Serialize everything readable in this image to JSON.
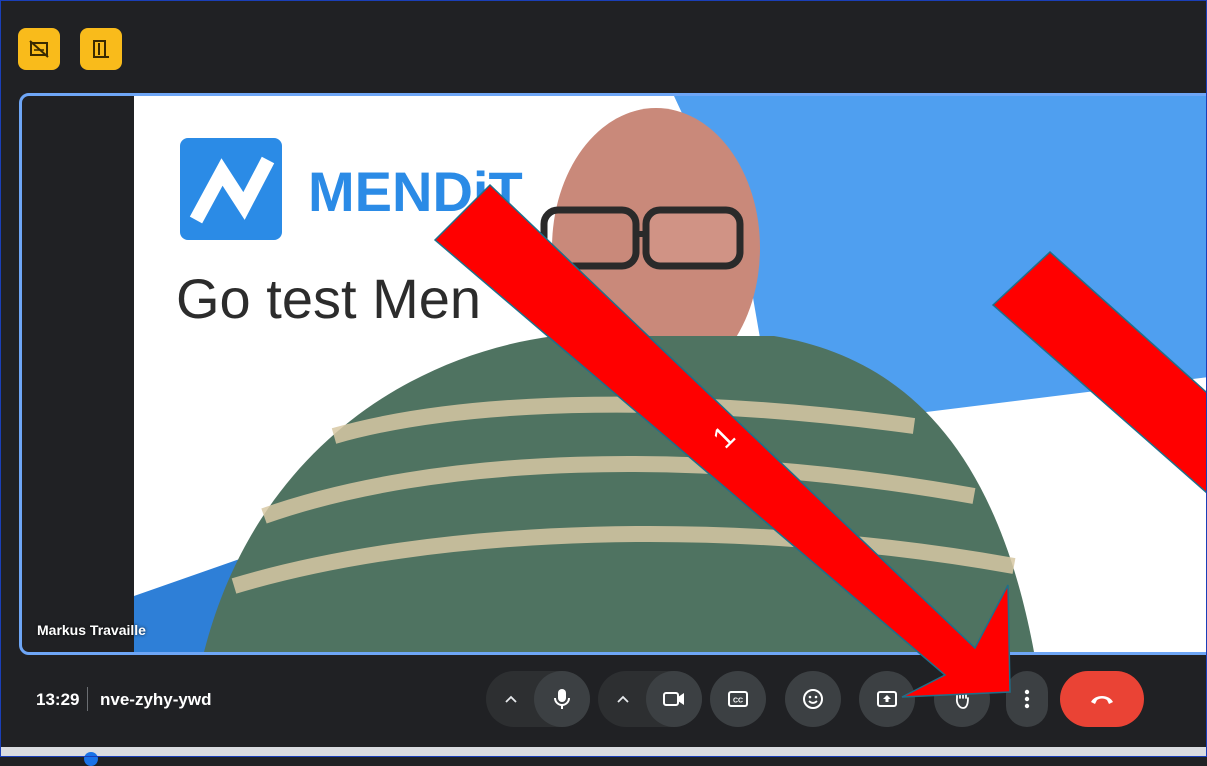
{
  "top_buttons": [
    {
      "name": "visual-effects-icon"
    },
    {
      "name": "breakout-rooms-icon"
    }
  ],
  "participant": {
    "name": "Markus Travaille"
  },
  "slide": {
    "brand": "MENDiT",
    "headline": "Go test Men"
  },
  "meeting": {
    "time": "13:29",
    "code": "nve-zyhy-ywd"
  },
  "annotation": {
    "label": "1",
    "arrow_color": "#ff0000"
  },
  "controls": [
    {
      "name": "microphone-icon"
    },
    {
      "name": "camera-icon"
    },
    {
      "name": "captions-icon"
    },
    {
      "name": "emoji-icon"
    },
    {
      "name": "present-screen-icon"
    },
    {
      "name": "raise-hand-icon"
    },
    {
      "name": "more-options-icon"
    },
    {
      "name": "end-call-icon"
    }
  ],
  "colors": {
    "background": "#202124",
    "accent_yellow": "#f9bb1b",
    "end_call_red": "#ea4335",
    "tile_border": "#6ea6f6",
    "slide_blue": "#4f9ff0",
    "logo_blue": "#2b8be6"
  }
}
